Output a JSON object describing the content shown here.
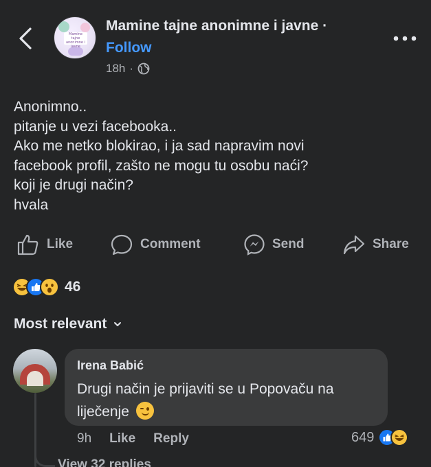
{
  "header": {
    "group_name": "Mamine tajne anonimne i javne ·",
    "follow_label": "Follow",
    "time": "18h",
    "separator": "·",
    "avatar_text": "Mamine tajne anonimne i javne"
  },
  "post": {
    "lines": [
      "Anonimno..",
      "pitanje u vezi facebooka..",
      "Ako me netko blokirao, i ja sad napravim novi",
      "facebook profil, zašto ne mogu tu osobu naći?",
      "koji je drugi način?",
      "hvala"
    ]
  },
  "actions": {
    "like": "Like",
    "comment": "Comment",
    "send": "Send",
    "share": "Share"
  },
  "reactions": {
    "count": "46",
    "types": [
      "haha",
      "like",
      "wow"
    ]
  },
  "comments_section": {
    "sort_label": "Most relevant"
  },
  "comment": {
    "author": "Irena Babić",
    "text": "Drugi način je prijaviti se u Popovaču na liječenje",
    "time": "9h",
    "like_label": "Like",
    "reply_label": "Reply",
    "reaction_count": "649",
    "reaction_types": [
      "like",
      "haha"
    ]
  },
  "view_replies_label": "View 32 replies",
  "colors": {
    "background": "#242526",
    "bubble": "#3a3b3c",
    "accent": "#4599ff",
    "text_primary": "#e4e6eb",
    "text_secondary": "#b0b3b8",
    "like_blue": "#1877f2",
    "emoji_yellow": "#f7c23e"
  }
}
